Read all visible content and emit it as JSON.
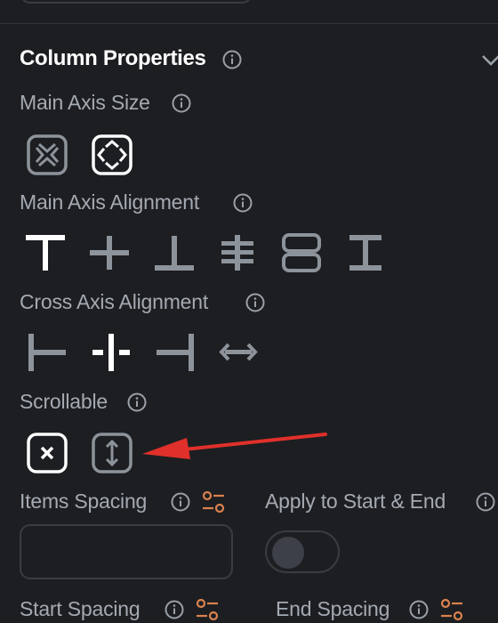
{
  "panel": {
    "section_title": "Column Properties",
    "main_axis_size": {
      "label": "Main Axis Size",
      "options": [
        "min-icon",
        "max-icon"
      ],
      "selected": 1
    },
    "main_axis_alignment": {
      "label": "Main Axis Alignment",
      "selected": 0,
      "options": [
        "align-start-icon",
        "align-center-icon",
        "align-end-icon",
        "space-between-icon",
        "space-around-icon",
        "space-evenly-icon"
      ]
    },
    "cross_axis_alignment": {
      "label": "Cross Axis Alignment",
      "selected": 1,
      "options": [
        "cross-start-icon",
        "cross-center-icon",
        "cross-end-icon",
        "stretch-icon"
      ]
    },
    "scrollable": {
      "label": "Scrollable",
      "options": [
        "not-scrollable-icon",
        "scrollable-icon"
      ],
      "selected": 0
    },
    "items_spacing": {
      "label": "Items Spacing",
      "value": ""
    },
    "apply_start_end": {
      "label": "Apply to Start & End",
      "on": false
    },
    "start_spacing": {
      "label": "Start Spacing"
    },
    "end_spacing": {
      "label": "End Spacing"
    }
  },
  "colors": {
    "background": "#1d1e21",
    "icon_muted": "#8d939b",
    "icon_active": "#ffffff",
    "accent_orange": "#d9824e",
    "annotation_arrow": "#e0302b"
  }
}
